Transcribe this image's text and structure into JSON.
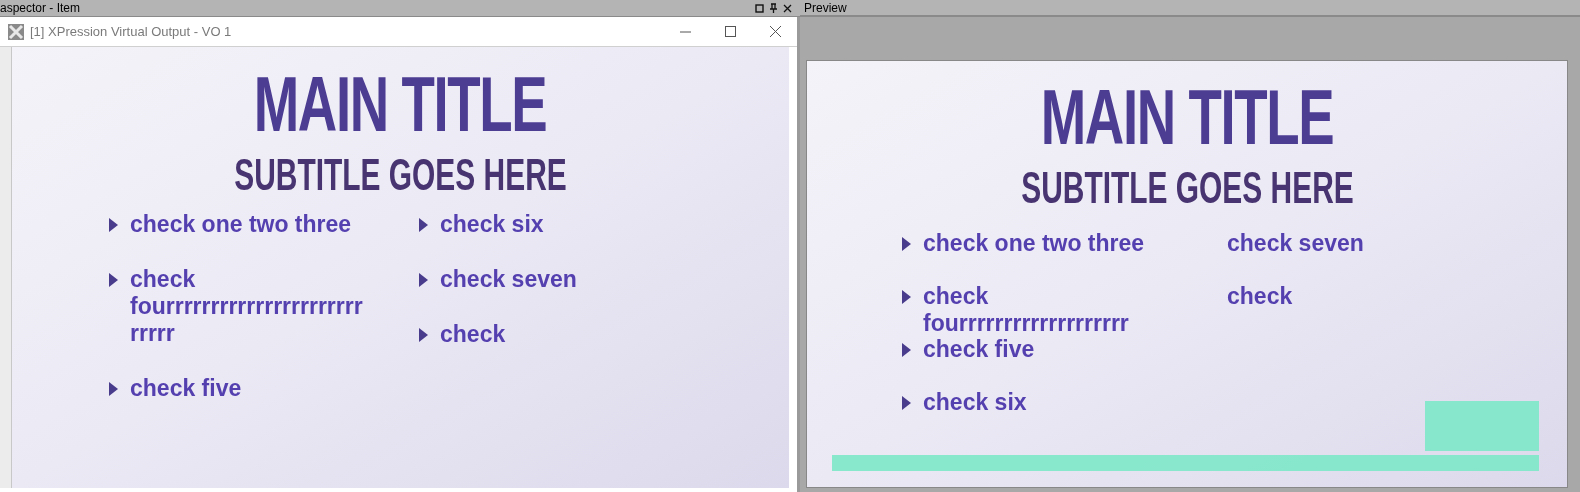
{
  "left_panel": {
    "title": "aspector - Item"
  },
  "right_panel": {
    "title": "Preview"
  },
  "output_window": {
    "title": "[1] XPression Virtual Output - VO 1",
    "slide": {
      "title": "MAIN TITLE",
      "subtitle": "SUBTITLE GOES HERE",
      "columns": [
        {
          "bullets": true,
          "items": [
            "check one two three",
            "check fourrrrrrrrrrrrrrrrrrrrrrrrrrr",
            "check five"
          ]
        },
        {
          "bullets": true,
          "items": [
            "check six",
            "check seven",
            "check"
          ]
        }
      ]
    }
  },
  "preview": {
    "slide": {
      "title": "MAIN TITLE",
      "subtitle": "SUBTITLE GOES HERE",
      "columns": [
        {
          "bullets": true,
          "items": [
            "check one two three",
            "check fourrrrrrrrrrrrrrrrrrr",
            "check five",
            "check six"
          ]
        },
        {
          "bullets": false,
          "items": [
            "check seven",
            "check"
          ]
        }
      ]
    }
  }
}
